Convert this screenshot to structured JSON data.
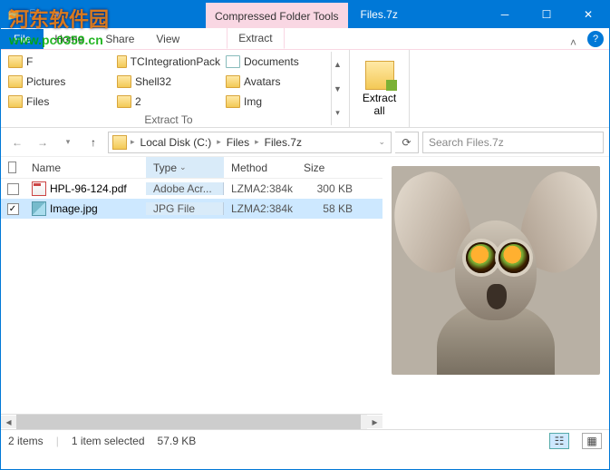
{
  "window": {
    "contextual_tab_header": "Compressed Folder Tools",
    "title": "Files.7z"
  },
  "watermark": {
    "text1": "河东软件园",
    "text2": "www.pc0359.cn"
  },
  "ribbon": {
    "tabs": {
      "file": "File",
      "home": "Home",
      "share": "Share",
      "view": "View",
      "extract": "Extract"
    },
    "dest": [
      {
        "label": "F"
      },
      {
        "label": "TCIntegrationPack"
      },
      {
        "label": "Documents",
        "doc": true
      },
      {
        "label": "Pictures"
      },
      {
        "label": "Shell32"
      },
      {
        "label": "Avatars"
      },
      {
        "label": "Files"
      },
      {
        "label": "2"
      },
      {
        "label": "Img"
      }
    ],
    "group_label": "Extract To",
    "extract_all": "Extract\nall"
  },
  "breadcrumbs": {
    "parts": [
      "Local Disk (C:)",
      "Files",
      "Files.7z"
    ]
  },
  "search": {
    "placeholder": "Search Files.7z"
  },
  "columns": {
    "name": "Name",
    "type": "Type",
    "method": "Method",
    "size": "Size"
  },
  "rows": [
    {
      "checked": false,
      "icon": "pdf",
      "name": "HPL-96-124.pdf",
      "type": "Adobe Acr...",
      "method": "LZMA2:384k",
      "size": "300 KB",
      "selected": false
    },
    {
      "checked": true,
      "icon": "jpg",
      "name": "Image.jpg",
      "type": "JPG File",
      "method": "LZMA2:384k",
      "size": "58 KB",
      "selected": true
    }
  ],
  "status": {
    "items": "2 items",
    "selected": "1 item selected",
    "size": "57.9 KB"
  }
}
